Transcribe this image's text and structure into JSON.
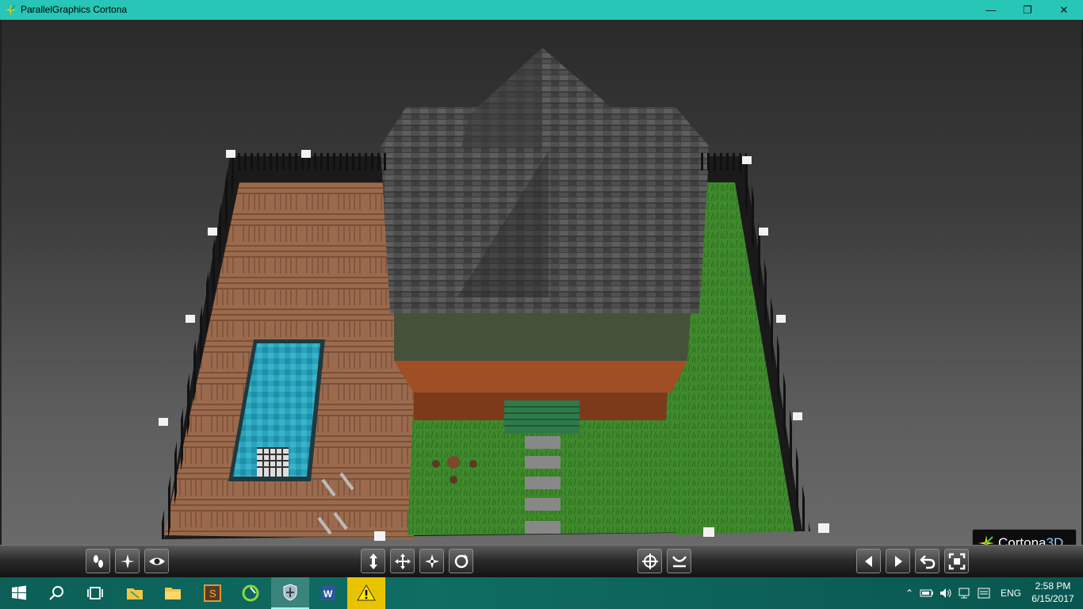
{
  "window": {
    "title": "ParallelGraphics Cortona",
    "minimize_glyph": "—",
    "maximize_glyph": "❐",
    "close_glyph": "✕"
  },
  "brand": {
    "name": "Cortona",
    "suffix": "3D"
  },
  "toolbar": {
    "nav_buttons": [
      "walk",
      "fly",
      "study"
    ],
    "move_buttons": [
      "plan",
      "pan",
      "turn",
      "roll"
    ],
    "view_buttons": [
      "goto",
      "align"
    ],
    "viewpoint_buttons": [
      "previous-viewpoint",
      "next-viewpoint",
      "restore",
      "fit"
    ]
  },
  "taskbar": {
    "apps": [
      "start",
      "search",
      "task-view",
      "file-explorer-1",
      "file-explorer-2",
      "app-s",
      "app-green",
      "cortona",
      "word",
      "warning"
    ],
    "language": "ENG",
    "time": "2:58 PM",
    "date": "6/15/2017"
  },
  "colors": {
    "titlebar": "#27c6b6",
    "taskbar": "#0f6d63",
    "grass": "#3c8a2c",
    "deck": "#9a6b4d",
    "pool": "#2f9fb5",
    "roof": "#4a4a4a"
  }
}
